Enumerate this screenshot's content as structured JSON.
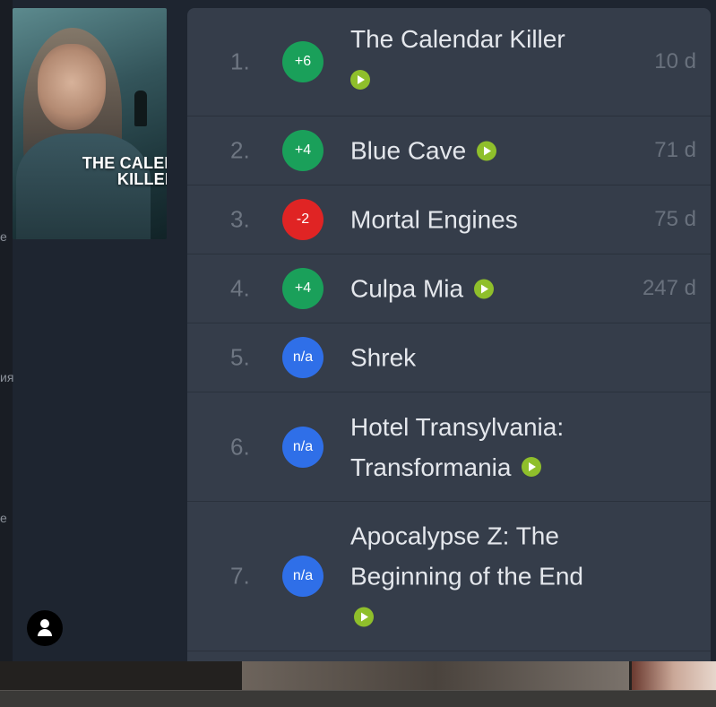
{
  "edge_labels": [
    "е",
    "ия",
    "е"
  ],
  "poster": {
    "title_line1": "THE CALENDAR",
    "title_line2": "KILLER"
  },
  "rows": [
    {
      "rank": "1.",
      "change": "+6",
      "trend": "up",
      "title": "The Calendar Killer",
      "play": true,
      "days": "10 d"
    },
    {
      "rank": "2.",
      "change": "+4",
      "trend": "up",
      "title": "Blue Cave",
      "play": true,
      "days": "71 d"
    },
    {
      "rank": "3.",
      "change": "-2",
      "trend": "down",
      "title": "Mortal Engines",
      "play": false,
      "days": "75 d"
    },
    {
      "rank": "4.",
      "change": "+4",
      "trend": "up",
      "title": "Culpa Mia",
      "play": true,
      "days": "247 d"
    },
    {
      "rank": "5.",
      "change": "n/a",
      "trend": "na",
      "title": "Shrek",
      "play": false,
      "days": ""
    },
    {
      "rank": "6.",
      "change": "n/a",
      "trend": "na",
      "title": "Hotel Transylvania: Transformania",
      "play": true,
      "days": ""
    },
    {
      "rank": "7.",
      "change": "n/a",
      "trend": "na",
      "title": "Apocalypse Z: The Beginning of the End",
      "play": true,
      "days": ""
    }
  ],
  "icons": {
    "play": "play-icon",
    "user": "user-icon"
  },
  "colors": {
    "up": "#1aa05a",
    "down": "#e02424",
    "na": "#2f6fe8",
    "play": "#8fbf2b"
  }
}
